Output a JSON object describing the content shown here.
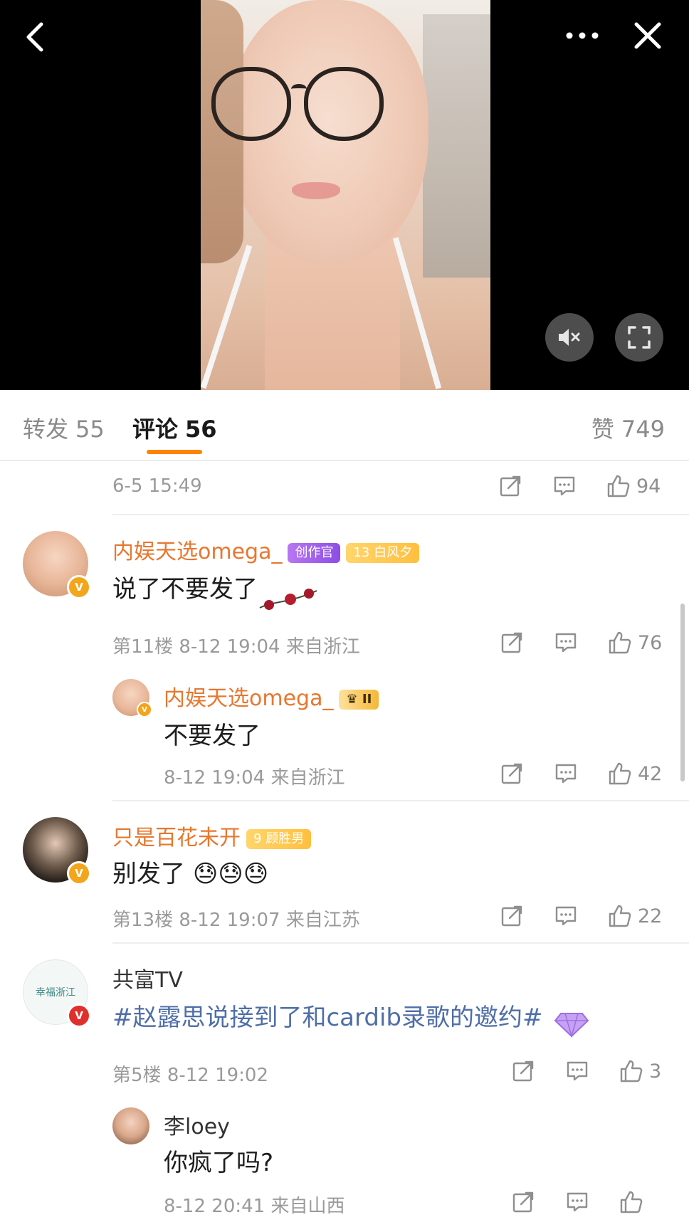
{
  "video": {
    "controls": {
      "back": "back-icon",
      "more": "more-icon",
      "close": "close-icon",
      "mute": "mute-icon",
      "fullscreen": "fullscreen-icon"
    }
  },
  "tabs": {
    "repost_label": "转发",
    "repost_count": "55",
    "comments_label": "评论",
    "comments_count": "56",
    "likes_label": "赞",
    "likes_count": "749"
  },
  "first_row": {
    "time": "6-5 15:49",
    "like_count": "94"
  },
  "comments": [
    {
      "username": "内娱天选omega_",
      "badges": [
        "创作官",
        "白风夕"
      ],
      "fan_level": "13",
      "text": "说了不要发了",
      "floor": "第11楼",
      "time": "8-12 19:04",
      "location": "来自浙江",
      "like_count": "76",
      "reply": {
        "username": "内娱天选omega_",
        "badge": "II",
        "text": "不要发了",
        "time": "8-12 19:04",
        "location": "来自浙江",
        "like_count": "42"
      }
    },
    {
      "username": "只是百花未开",
      "badges": [
        "顾胜男"
      ],
      "fan_level": "9",
      "text": "别发了",
      "emoji": [
        "😓",
        "😓",
        "😓"
      ],
      "floor": "第13楼",
      "time": "8-12 19:07",
      "location": "来自江苏",
      "like_count": "22"
    },
    {
      "username": "共富TV",
      "avatar_text": "幸福浙江",
      "text": "#赵露思说接到了和cardib录歌的邀约#",
      "floor": "第5楼",
      "time": "8-12 19:02",
      "like_count": "3",
      "reply": {
        "username": "李loey",
        "text": "你疯了吗?",
        "time": "8-12 20:41",
        "location": "来自山西"
      }
    }
  ],
  "colors": {
    "accent": "#ff8200",
    "username": "#e8772e",
    "topic": "#4f6ea8",
    "meta": "#9a9a9a"
  }
}
